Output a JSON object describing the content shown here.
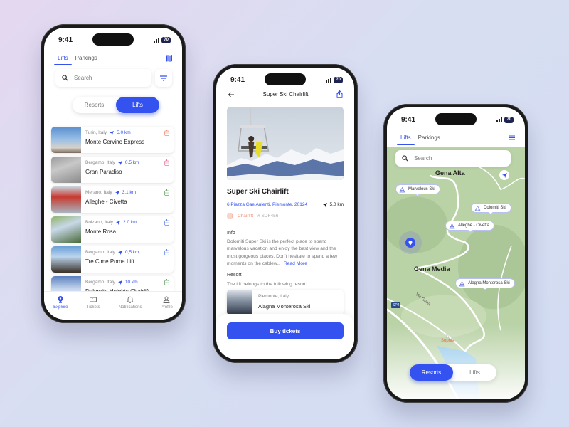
{
  "status": {
    "time": "9:41",
    "battery": "70"
  },
  "phone1": {
    "tabs": [
      {
        "label": "Lifts",
        "active": true
      },
      {
        "label": "Parkings",
        "active": false
      }
    ],
    "search": {
      "placeholder": "Search"
    },
    "segment": [
      {
        "label": "Resorts",
        "active": false
      },
      {
        "label": "Lifts",
        "active": true
      }
    ],
    "lifts": [
      {
        "location": "Turin, Italy",
        "distance": "5.0 km",
        "name": "Monte Cervino Express",
        "type_icon": "cable-car-icon",
        "icon_color": "#f0907a"
      },
      {
        "location": "Bergamo, Italy",
        "distance": "0,5 km",
        "name": "Gran Paradiso",
        "type_icon": "cable-car-icon",
        "icon_color": "#ec7fa0"
      },
      {
        "location": "Merano, Italy",
        "distance": "3,1 km",
        "name": "Alleghe - Civetta",
        "type_icon": "gondola-icon",
        "icon_color": "#6ca86a"
      },
      {
        "location": "Bolzano, Italy",
        "distance": "2.0 km",
        "name": "Monte Rosa",
        "type_icon": "ski-lift-icon",
        "icon_color": "#6a8af0"
      },
      {
        "location": "Bergamo, Italy",
        "distance": "0,5 km",
        "name": "Tre Cime Poma Lift",
        "type_icon": "ski-lift-icon",
        "icon_color": "#6a8af0"
      },
      {
        "location": "Bergamo, Italy",
        "distance": "10 km",
        "name": "Dolomite Heights Chairlift",
        "type_icon": "gondola-icon",
        "icon_color": "#6ca86a"
      }
    ],
    "nav": [
      {
        "label": "Explore",
        "icon": "location-pin-icon",
        "active": true
      },
      {
        "label": "Tickets",
        "icon": "ticket-icon",
        "active": false
      },
      {
        "label": "Notifications",
        "icon": "bell-icon",
        "active": false
      },
      {
        "label": "Profile",
        "icon": "user-icon",
        "active": false
      }
    ]
  },
  "phone2": {
    "header_title": "Super Ski Chairlift",
    "title": "Super Ski Chairlift",
    "address": "6 Piazza Gae Aulenti, Piemonte, 20124",
    "distance": "5.0 km",
    "type": "Chairlift",
    "code": "# SDF456",
    "info_label": "Info",
    "info_text": "Dolomiti Super Ski is the perfect place to spend marvelous vacation and enjoy the best view and the most gorgeous places. Don't hesitate to spend a few moments on the cablew..",
    "read_more": "Read More",
    "resort_label": "Resort",
    "resort_text": "The lift belongs to the following resort:",
    "resort": {
      "location": "Piemonte, Italy",
      "name": "Alagna Monterosa Ski"
    },
    "buy_label": "Buy tickets"
  },
  "phone3": {
    "tabs": [
      {
        "label": "Lifts",
        "active": true
      },
      {
        "label": "Parkings",
        "active": false
      }
    ],
    "search": {
      "placeholder": "Search"
    },
    "places": {
      "top": "Gena Alta",
      "middle": "Gena Media",
      "road": "Via Gena",
      "road_code": "SP2",
      "poi": "Sophia"
    },
    "pins": [
      "Marvelous Ski",
      "Dolomiti Ski",
      "Alleghe - Civetta",
      "Alagna Monterosa Ski"
    ],
    "segment": [
      {
        "label": "Resorts",
        "active": true
      },
      {
        "label": "Lifts",
        "active": false
      }
    ]
  },
  "colors": {
    "accent": "#3452f0",
    "chairlift": "#f0907a"
  }
}
